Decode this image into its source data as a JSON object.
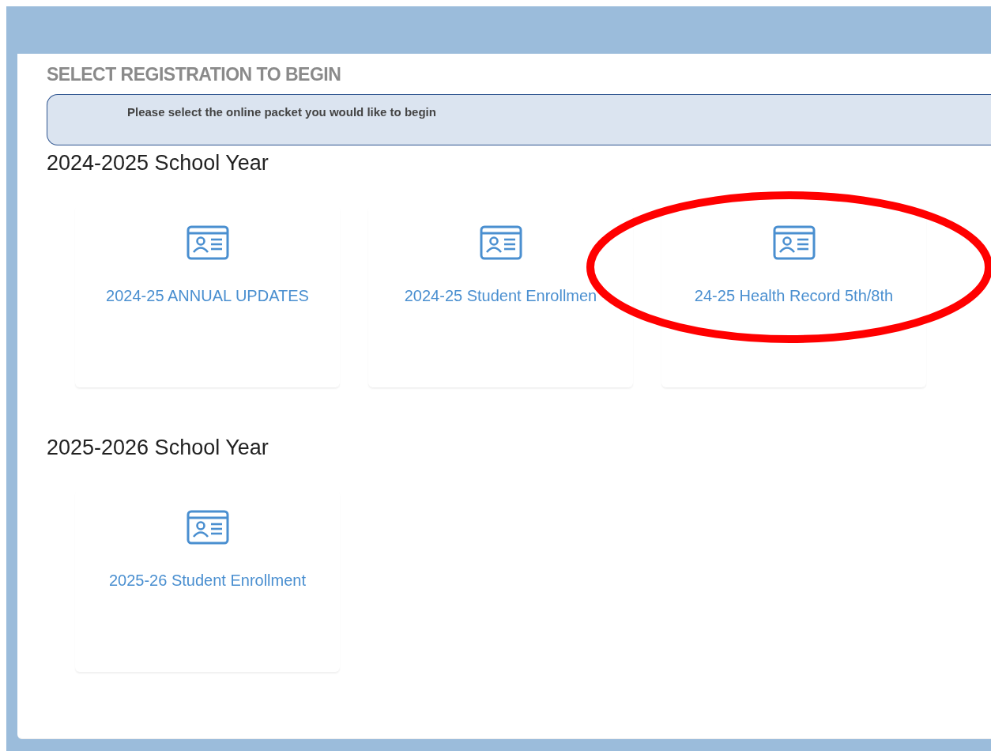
{
  "page": {
    "heading": "SELECT REGISTRATION TO BEGIN",
    "instruction": "Please select the online packet you would like to begin"
  },
  "sections": [
    {
      "title": "2024-2025 School Year",
      "packets": [
        {
          "label": "2024-25 ANNUAL UPDATES"
        },
        {
          "label": "2024-25 Student Enrollmen"
        },
        {
          "label": "24-25 Health Record 5th/8th"
        }
      ]
    },
    {
      "title": "2025-2026 School Year",
      "packets": [
        {
          "label": "2025-26 Student Enrollment"
        }
      ]
    }
  ],
  "annotation": {
    "kind": "ellipse",
    "color": "#ff0000"
  }
}
